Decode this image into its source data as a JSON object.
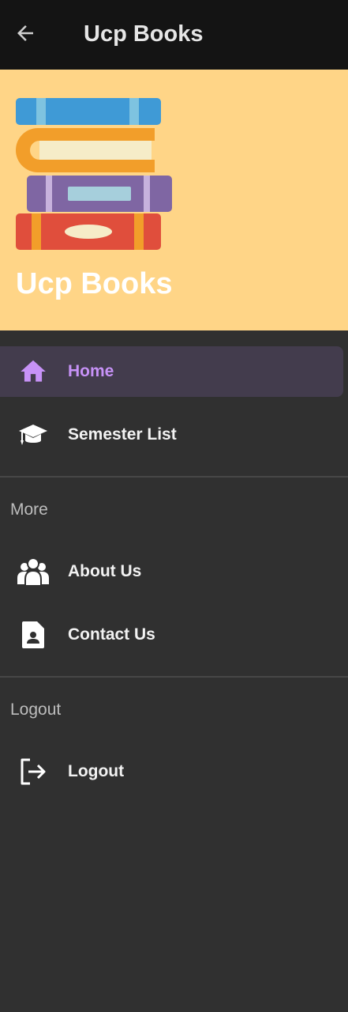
{
  "toolbar": {
    "back_icon": "arrow-back-icon",
    "title": "Ucp Books"
  },
  "drawer_header": {
    "logo_icon": "book-stack-icon",
    "title": "Ucp Books",
    "background_color": "#ffd587"
  },
  "menu": {
    "primary_items": [
      {
        "label": "Home",
        "icon": "home-icon",
        "active": true
      },
      {
        "label": "Semester List",
        "icon": "graduation-cap-icon",
        "active": false
      }
    ],
    "sections": [
      {
        "header": "More",
        "items": [
          {
            "label": "About Us",
            "icon": "users-icon"
          },
          {
            "label": "Contact Us",
            "icon": "contact-card-icon"
          }
        ]
      },
      {
        "header": "Logout",
        "items": [
          {
            "label": "Logout",
            "icon": "logout-icon"
          }
        ]
      }
    ]
  },
  "colors": {
    "active_accent": "#c792f7",
    "active_background": "#433c4d",
    "drawer_background": "#303030",
    "toolbar_background": "#141414"
  }
}
